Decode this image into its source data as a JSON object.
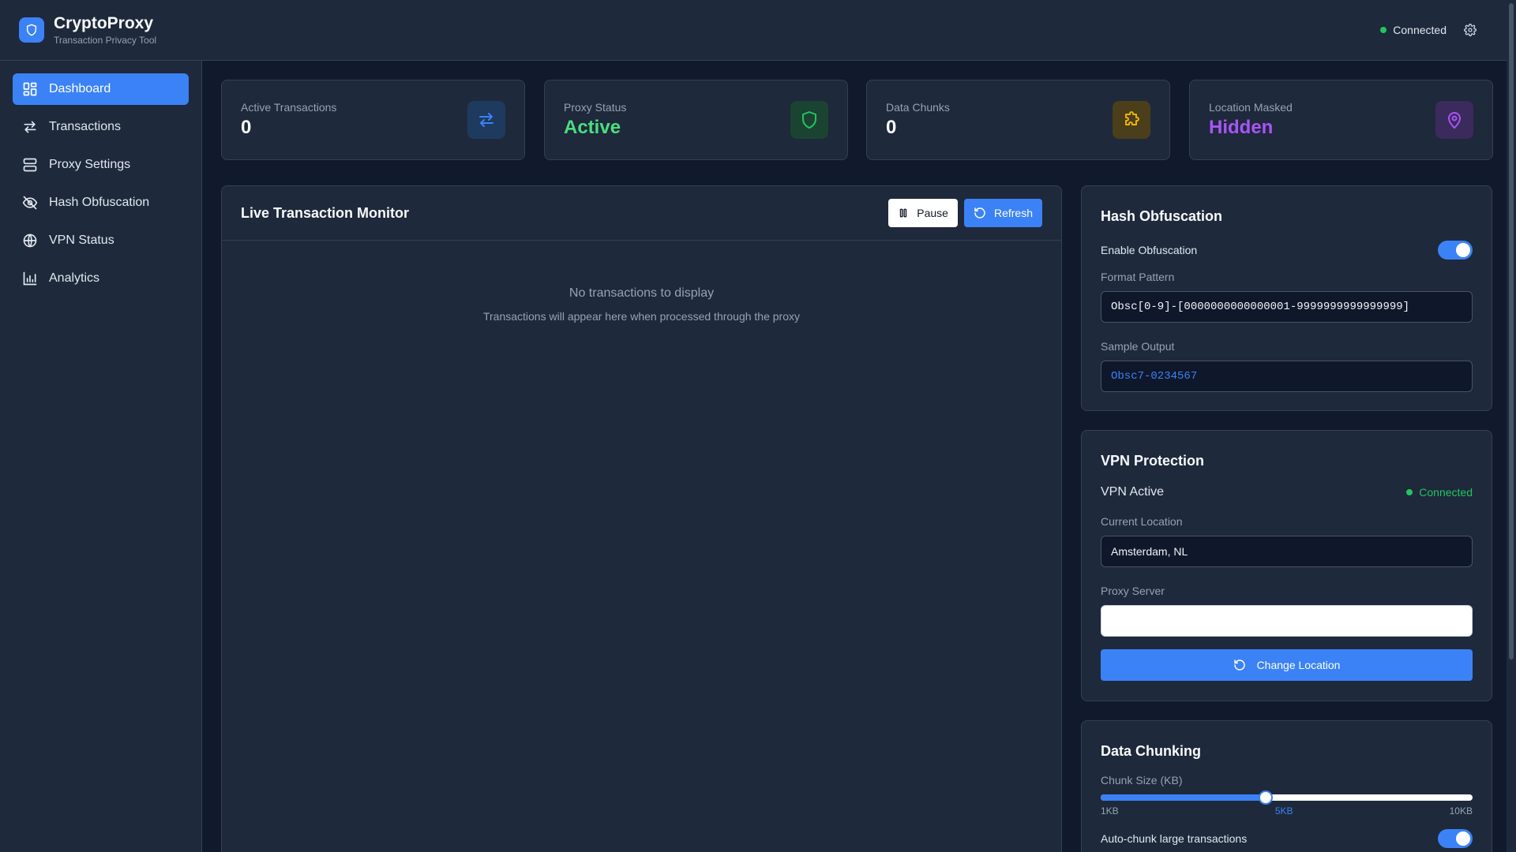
{
  "app": {
    "title": "CryptoProxy",
    "subtitle": "Transaction Privacy Tool",
    "connection_status": "Connected"
  },
  "sidebar": {
    "items": [
      {
        "label": "Dashboard",
        "icon": "dashboard-icon",
        "active": true
      },
      {
        "label": "Transactions",
        "icon": "arrows-swap-icon"
      },
      {
        "label": "Proxy Settings",
        "icon": "server-icon"
      },
      {
        "label": "Hash Obfuscation",
        "icon": "eye-off-icon"
      },
      {
        "label": "VPN Status",
        "icon": "globe-icon"
      },
      {
        "label": "Analytics",
        "icon": "bar-chart-icon"
      }
    ]
  },
  "stats": [
    {
      "label": "Active Transactions",
      "value": "0",
      "color": "#f8fafc",
      "icon": "arrows-swap-icon"
    },
    {
      "label": "Proxy Status",
      "value": "Active",
      "color": "#4ade80",
      "icon": "shield-icon"
    },
    {
      "label": "Data Chunks",
      "value": "0",
      "color": "#f8fafc",
      "icon": "puzzle-icon"
    },
    {
      "label": "Location Masked",
      "value": "Hidden",
      "color": "#a855f7",
      "icon": "map-pin-icon"
    }
  ],
  "monitor": {
    "title": "Live Transaction Monitor",
    "pause_label": "Pause",
    "refresh_label": "Refresh",
    "empty_title": "No transactions to display",
    "empty_subtitle": "Transactions will appear here when processed through the proxy"
  },
  "hash": {
    "title": "Hash Obfuscation",
    "enable_label": "Enable Obfuscation",
    "enabled": true,
    "format_label": "Format Pattern",
    "format_value": "Obsc[0-9]-[0000000000000001-9999999999999999]",
    "sample_label": "Sample Output",
    "sample_value": "Obsc7-0234567"
  },
  "vpn": {
    "title": "VPN Protection",
    "active_label": "VPN Active",
    "status": "Connected",
    "location_label": "Current Location",
    "location_value": "Amsterdam, NL",
    "proxy_label": "Proxy Server",
    "proxy_value": "",
    "change_label": "Change Location"
  },
  "chunking": {
    "title": "Data Chunking",
    "size_label": "Chunk Size (KB)",
    "min_label": "1KB",
    "current_label": "5KB",
    "max_label": "10KB",
    "min": 1,
    "max": 10,
    "value": 5,
    "auto_label": "Auto-chunk large transactions",
    "auto_enabled": true
  },
  "colors": {
    "accent": "#3b82f6",
    "success": "#22c55e",
    "warning": "#eab308",
    "purple": "#a855f7"
  }
}
